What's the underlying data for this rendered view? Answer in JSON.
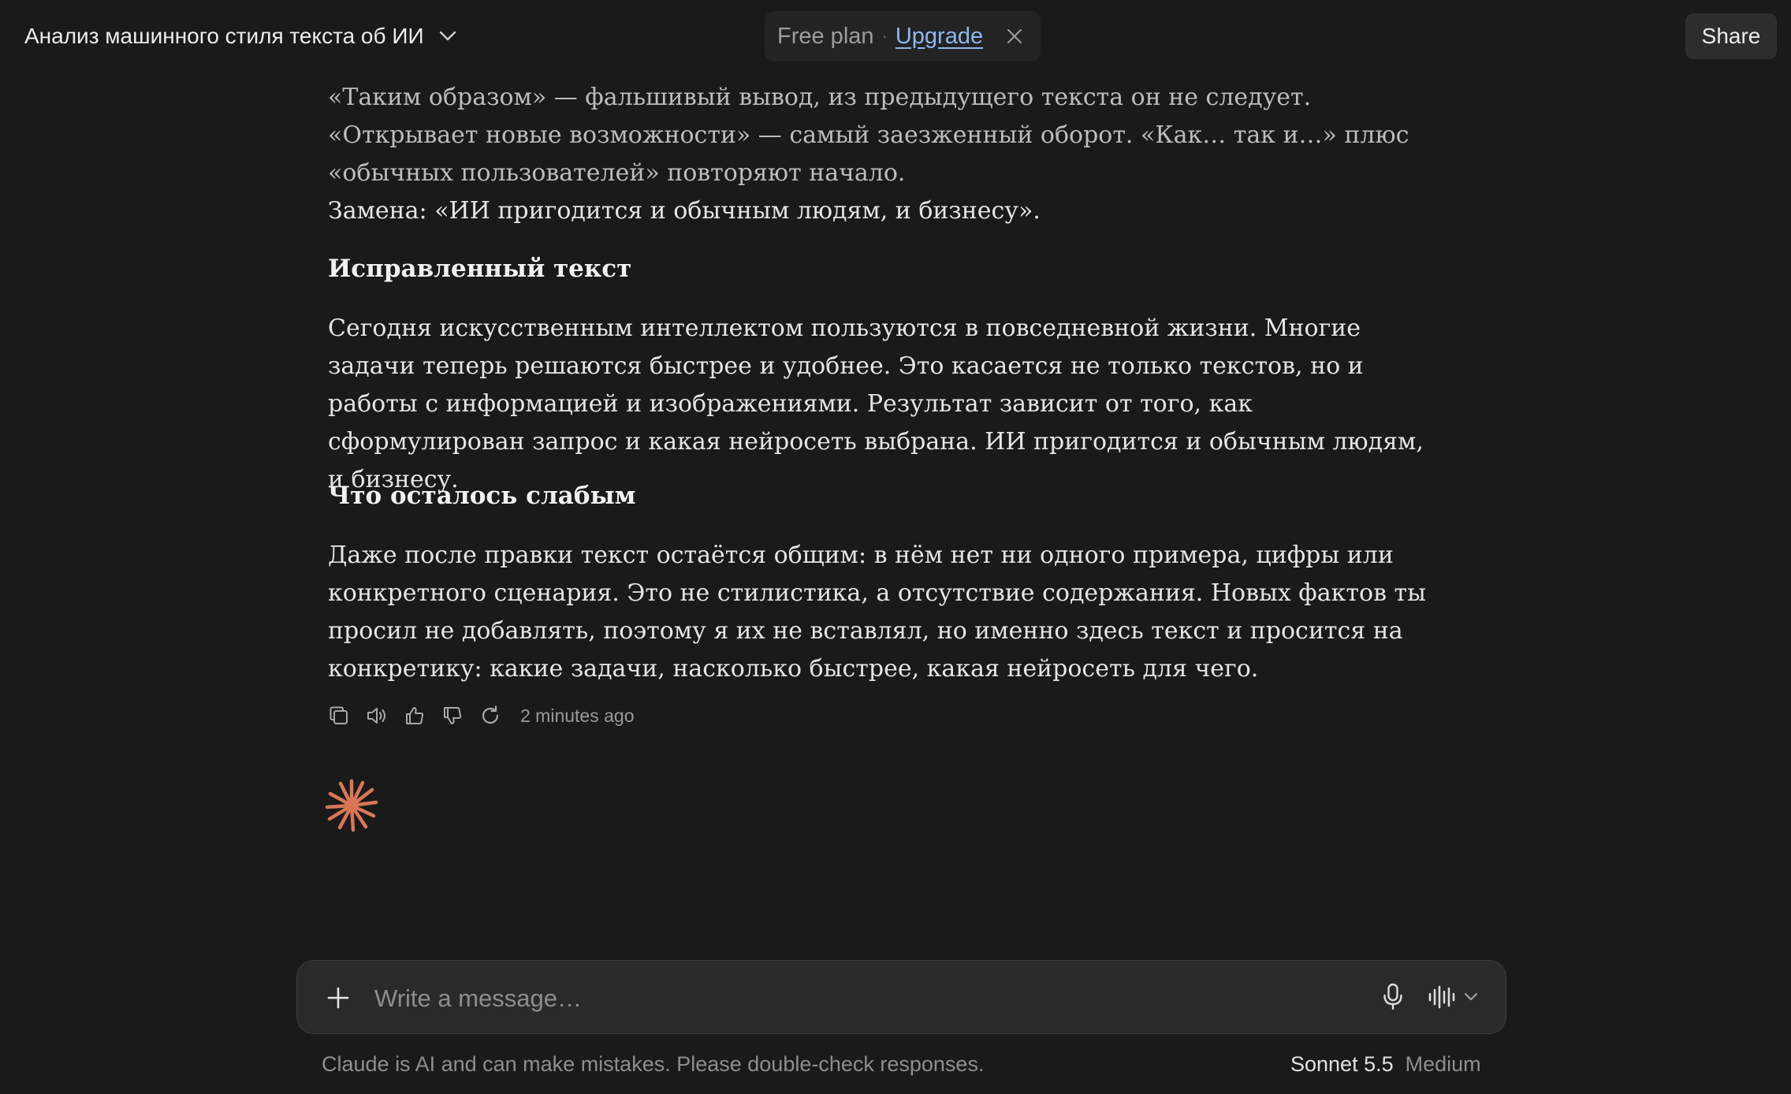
{
  "header": {
    "chat_title": "Анализ машинного стиля текста об ИИ",
    "plan_label": "Free plan",
    "plan_separator": "·",
    "upgrade_label": "Upgrade",
    "share_label": "Share"
  },
  "message": {
    "paragraph_1": "«Таким образом» — фальшивый вывод, из предыдущего текста он не следует. «Открывает новые возможности» — самый заезженный оборот. «Как… так и…» плюс «обычных пользователей» повторяют начало.",
    "replacement_line": "Замена: «ИИ пригодится и обычным людям, и бизнесу».",
    "heading_1": "Исправленный текст",
    "paragraph_2": "Сегодня искусственным интеллектом пользуются в повседневной жизни. Многие задачи теперь решаются быстрее и удобнее. Это касается не только текстов, но и работы с информацией и изображениями. Результат зависит от того, как сформулирован запрос и какая нейросеть выбрана. ИИ пригодится и обычным людям, и бизнесу.",
    "heading_2": "Что осталось слабым",
    "paragraph_3": "Даже после правки текст остаётся общим: в нём нет ни одного примера, цифры или конкретного сценария. Это не стилистика, а отсутствие содержания. Новых фактов ты просил не добавлять, поэтому я их не вставлял, но именно здесь текст и просится на конкретику: какие задачи, насколько быстрее, какая нейросеть для чего.",
    "timestamp": "2 minutes ago",
    "actions": [
      "copy-icon",
      "speaker-icon",
      "thumbs-up-icon",
      "thumbs-down-icon",
      "retry-icon"
    ]
  },
  "composer": {
    "placeholder": "Write a message…"
  },
  "footer": {
    "disclaimer": "Claude is AI and can make mistakes. Please double-check responses.",
    "model_name": "Sonnet 5.5",
    "model_effort": "Medium"
  },
  "colors": {
    "background": "#1a1a1a",
    "accent_orange": "#d97757",
    "link_blue": "#8fb7ee"
  }
}
